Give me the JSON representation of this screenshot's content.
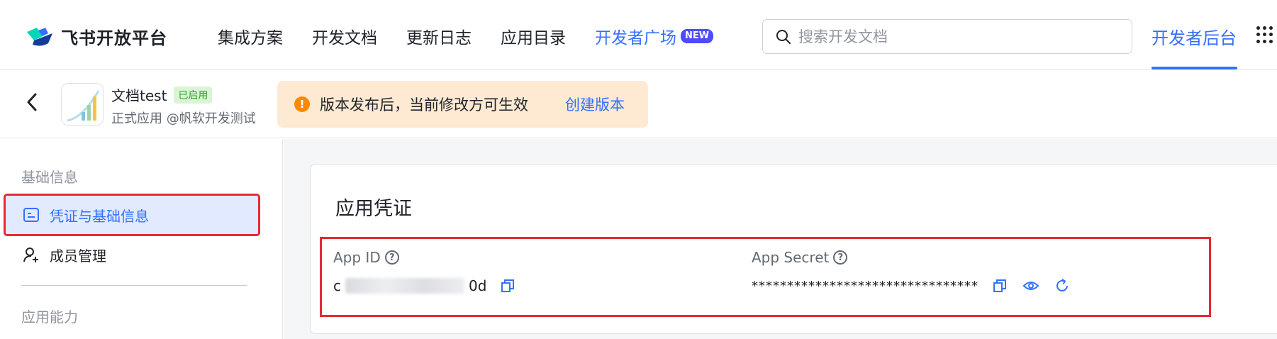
{
  "nav": {
    "brand": "飞书开放平台",
    "links": [
      "集成方案",
      "开发文档",
      "更新日志",
      "应用目录"
    ],
    "dev_square": "开发者广场",
    "new_badge": "NEW",
    "search_placeholder": "搜索开发文档",
    "console": "开发者后台"
  },
  "app": {
    "name": "文档test",
    "status": "已启用",
    "subtitle": "正式应用 @帆软开发测试"
  },
  "notice": {
    "icon": "!",
    "text": "版本发布后，当前修改方可生效",
    "link": "创建版本"
  },
  "sidebar": {
    "section1": "基础信息",
    "items": [
      {
        "label": "凭证与基础信息",
        "icon": "credential-icon"
      },
      {
        "label": "成员管理",
        "icon": "add-user-icon"
      }
    ],
    "section2": "应用能力"
  },
  "credentials": {
    "title": "应用凭证",
    "app_id_label": "App ID",
    "app_id_prefix": "c",
    "app_id_suffix": "0d",
    "app_secret_label": "App Secret",
    "app_secret_masked": "********************************"
  },
  "colors": {
    "accent": "#3370ff",
    "highlight_border": "#e32b35",
    "notice_bg": "#feead2"
  }
}
